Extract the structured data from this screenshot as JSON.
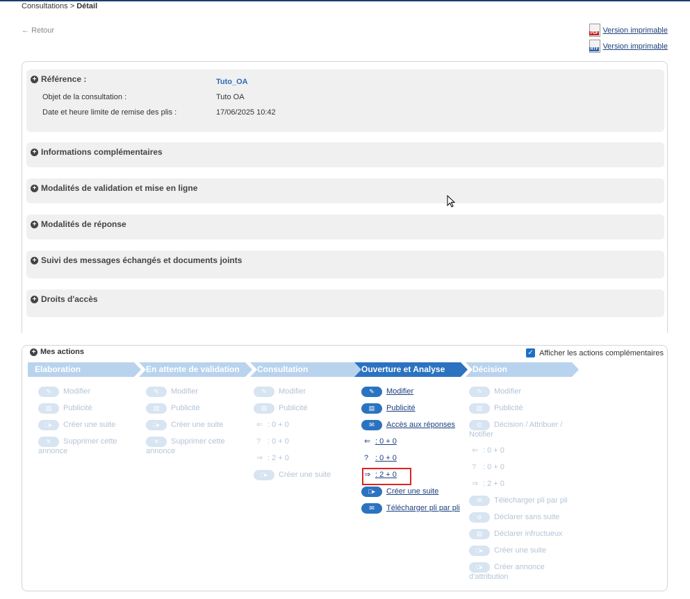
{
  "breadcrumb": {
    "parent": "Consultations",
    "separator": " > ",
    "current": "Détail"
  },
  "back_label": "Retour",
  "print": {
    "pdf_label": "Version imprimable",
    "rtf_label": "Version imprimable",
    "pdf_badge": "PDF",
    "rtf_badge": "RTF"
  },
  "reference": {
    "title": "Référence :",
    "value": "Tuto_OA",
    "object_label": "Objet de la consultation :",
    "object_value": "Tuto OA",
    "deadline_label": "Date et heure limite de remise des plis :",
    "deadline_value": "17/06/2025 10:42"
  },
  "sections": [
    "Informations complémentaires",
    "Modalités de validation et mise en ligne",
    "Modalités de réponse",
    "Suivi des messages échangés et documents joints",
    "Droits d'accès"
  ],
  "actions": {
    "title": "Mes actions",
    "toggle_label": "Afficher les actions complémentaires",
    "toggle_checked": true,
    "steps": [
      "Elaboration",
      "En attente de validation",
      "Consultation",
      "Ouverture et Analyse",
      "Décision"
    ],
    "active_step": "Ouverture et Analyse",
    "labels": {
      "modifier": "Modifier",
      "publicite": "Publicité",
      "creer_suite": "Créer une suite",
      "supprimer": "Supprimer cette annonce",
      "acces_reponses": "Accès aux réponses",
      "telecharger": "Télécharger pli par pli",
      "decision": "Décision / Attribuer / Notifier",
      "declarer_sans_suite": "Déclarer sans suite",
      "declarer_infructueux": "Déclarer infructueux",
      "creer_annonce": "Créer annonce d'attribution"
    },
    "counters": {
      "retraits": ": 0 + 0",
      "questions": ": 0 + 0",
      "depots": ": 2 + 0"
    }
  }
}
